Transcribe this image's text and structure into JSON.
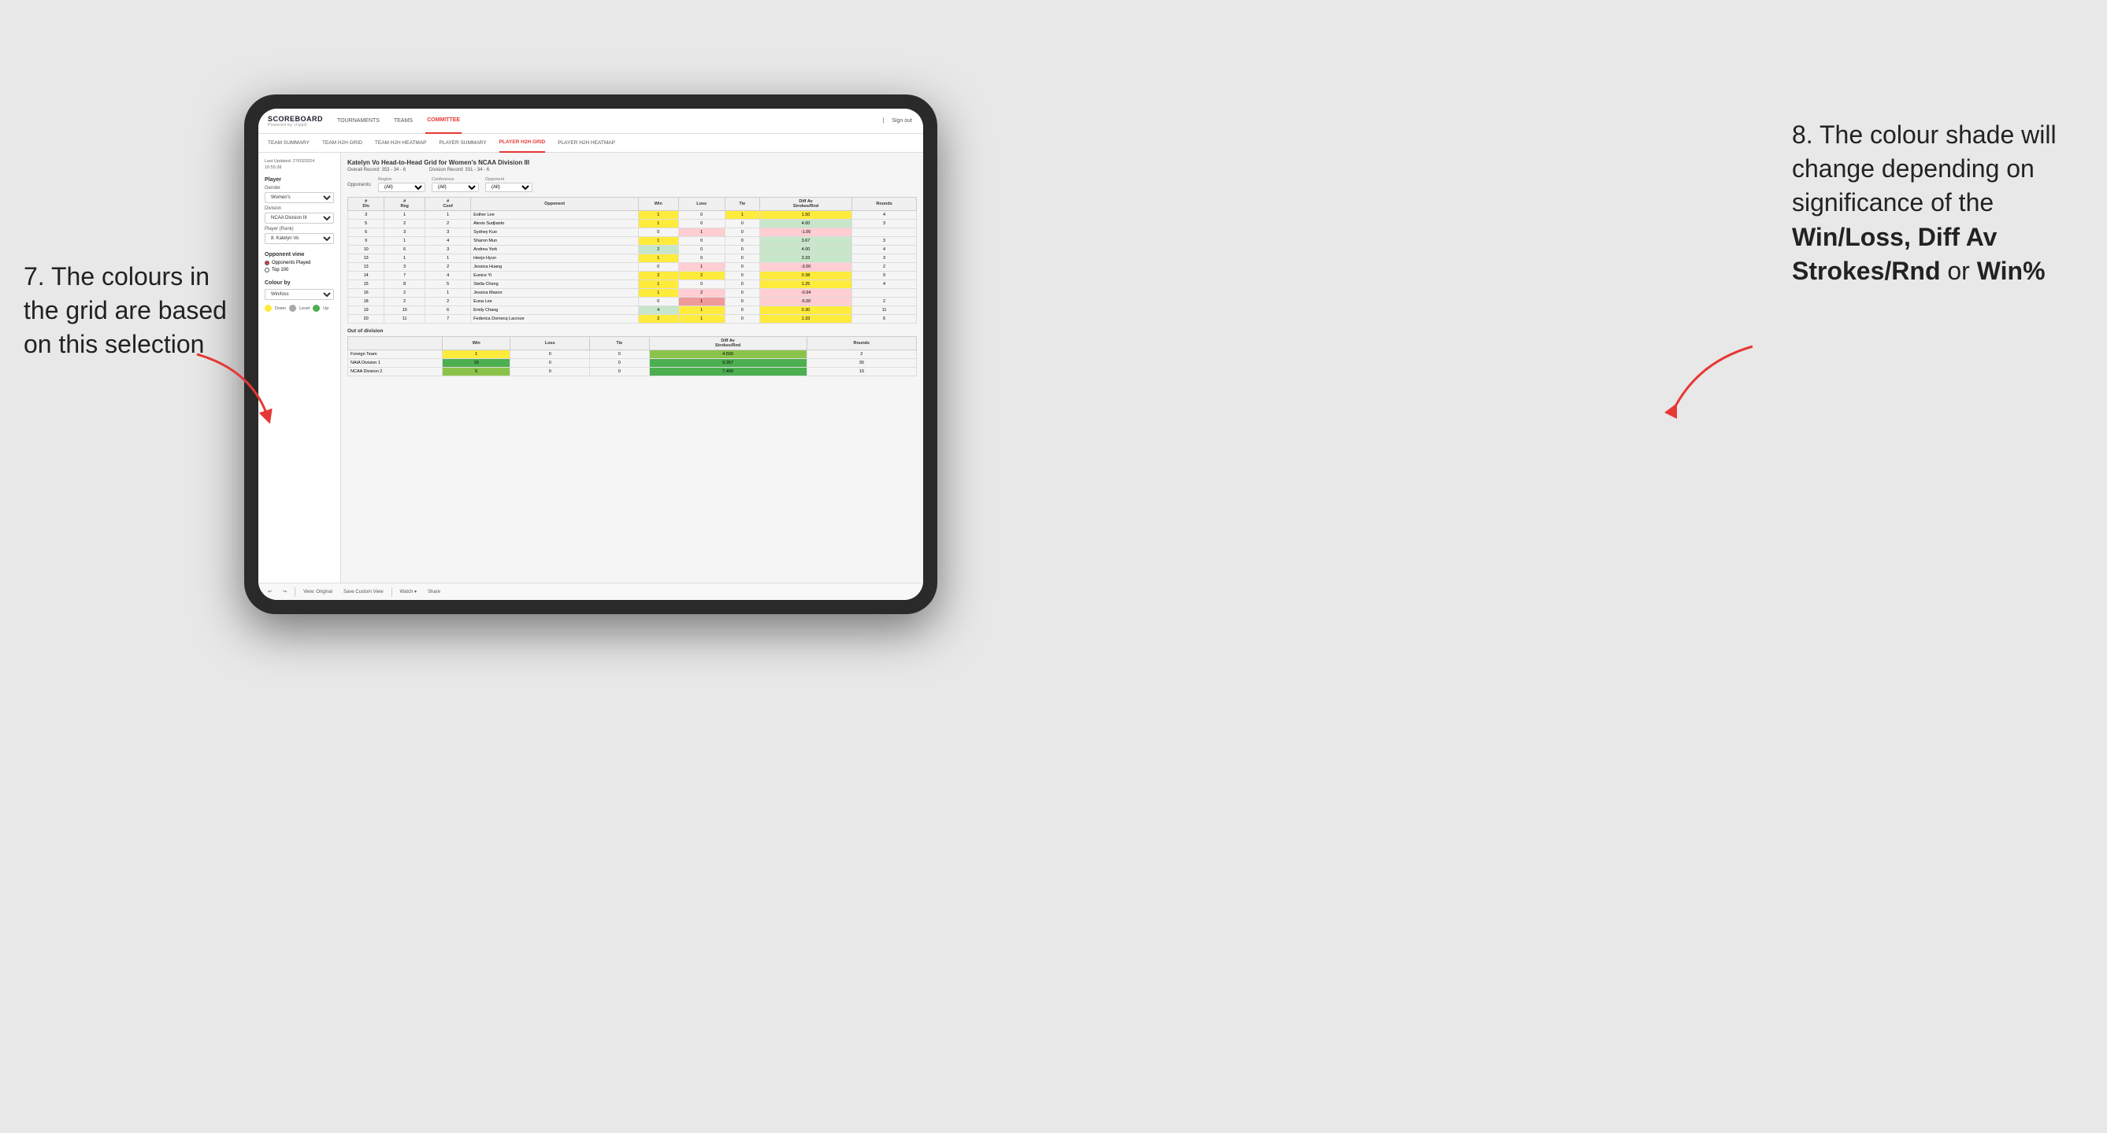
{
  "annotations": {
    "left_title": "7. The colours in the grid are based on this selection",
    "right_title": "8. The colour shade will change depending on significance of the",
    "right_bold1": "Win/Loss,",
    "right_bold2": "Diff Av Strokes/Rnd",
    "right_or": "or",
    "right_bold3": "Win%"
  },
  "nav": {
    "logo": "SCOREBOARD",
    "logo_sub": "Powered by clippd",
    "items": [
      "TOURNAMENTS",
      "TEAMS",
      "COMMITTEE"
    ],
    "right": [
      "Sign out"
    ],
    "active": "COMMITTEE"
  },
  "subnav": {
    "items": [
      "TEAM SUMMARY",
      "TEAM H2H GRID",
      "TEAM H2H HEATMAP",
      "PLAYER SUMMARY",
      "PLAYER H2H GRID",
      "PLAYER H2H HEATMAP"
    ],
    "active": "PLAYER H2H GRID"
  },
  "left_panel": {
    "last_updated_label": "Last Updated: 27/03/2024",
    "last_updated_time": "16:55:38",
    "player_section": "Player",
    "gender_label": "Gender",
    "gender_value": "Women's",
    "division_label": "Division",
    "division_value": "NCAA Division III",
    "player_rank_label": "Player (Rank)",
    "player_rank_value": "8. Katelyn Vo",
    "opponent_view_label": "Opponent view",
    "opponents_played_label": "Opponents Played",
    "top_100_label": "Top 100",
    "colour_by_label": "Colour by",
    "colour_by_value": "Win/loss",
    "legend_down": "Down",
    "legend_level": "Level",
    "legend_up": "Up"
  },
  "grid": {
    "title": "Katelyn Vo Head-to-Head Grid for Women's NCAA Division III",
    "overall_record_label": "Overall Record:",
    "overall_record_value": "353 - 34 - 6",
    "division_record_label": "Division Record:",
    "division_record_value": "331 - 34 - 6",
    "opponents_label": "Opponents:",
    "region_label": "Region",
    "conference_label": "Conference",
    "opponent_label": "Opponent",
    "filter_all": "(All)",
    "columns": {
      "div": "#\nDiv",
      "reg": "#\nReg",
      "conf": "#\nConf",
      "opponent": "Opponent",
      "win": "Win",
      "loss": "Loss",
      "tie": "Tie",
      "diff_av": "Diff Av\nStrokes/Rnd",
      "rounds": "Rounds"
    },
    "rows": [
      {
        "div": 3,
        "reg": 1,
        "conf": 1,
        "opponent": "Esther Lee",
        "win": 1,
        "loss": 0,
        "tie": 1,
        "diff_av": 1.5,
        "rounds": 4,
        "win_color": "yellow",
        "loss_color": "neutral",
        "tie_color": "yellow"
      },
      {
        "div": 5,
        "reg": 2,
        "conf": 2,
        "opponent": "Alexis Sudjianto",
        "win": 1,
        "loss": 0,
        "tie": 0,
        "diff_av": 4.0,
        "rounds": 3,
        "win_color": "yellow",
        "loss_color": "neutral",
        "tie_color": "neutral"
      },
      {
        "div": 6,
        "reg": 3,
        "conf": 3,
        "opponent": "Sydney Kuo",
        "win": 0,
        "loss": 1,
        "tie": 0,
        "diff_av": -1.0,
        "rounds": "",
        "win_color": "neutral",
        "loss_color": "red-light",
        "tie_color": "neutral"
      },
      {
        "div": 9,
        "reg": 1,
        "conf": 4,
        "opponent": "Sharon Mun",
        "win": 1,
        "loss": 0,
        "tie": 0,
        "diff_av": 3.67,
        "rounds": 3,
        "win_color": "yellow",
        "loss_color": "neutral",
        "tie_color": "neutral"
      },
      {
        "div": 10,
        "reg": 6,
        "conf": 3,
        "opponent": "Andrea York",
        "win": 2,
        "loss": 0,
        "tie": 0,
        "diff_av": 4.0,
        "rounds": 4,
        "win_color": "green-light",
        "loss_color": "neutral",
        "tie_color": "neutral"
      },
      {
        "div": 13,
        "reg": 1,
        "conf": 1,
        "opponent": "Heejo Hyun",
        "win": 1,
        "loss": 0,
        "tie": 0,
        "diff_av": 3.33,
        "rounds": 3,
        "win_color": "yellow",
        "loss_color": "neutral",
        "tie_color": "neutral"
      },
      {
        "div": 13,
        "reg": 3,
        "conf": 2,
        "opponent": "Jessica Huang",
        "win": 0,
        "loss": 1,
        "tie": 0,
        "diff_av": -3.0,
        "rounds": 2,
        "win_color": "neutral",
        "loss_color": "red-light",
        "tie_color": "neutral"
      },
      {
        "div": 14,
        "reg": 7,
        "conf": 4,
        "opponent": "Eunice Yi",
        "win": 2,
        "loss": 2,
        "tie": 0,
        "diff_av": 0.38,
        "rounds": 9,
        "win_color": "yellow",
        "loss_color": "yellow",
        "tie_color": "neutral"
      },
      {
        "div": 15,
        "reg": 8,
        "conf": 5,
        "opponent": "Stella Cheng",
        "win": 1,
        "loss": 0,
        "tie": 0,
        "diff_av": 1.25,
        "rounds": 4,
        "win_color": "yellow",
        "loss_color": "neutral",
        "tie_color": "neutral"
      },
      {
        "div": 16,
        "reg": 2,
        "conf": 1,
        "opponent": "Jessica Mason",
        "win": 1,
        "loss": 2,
        "tie": 0,
        "diff_av": -0.94,
        "rounds": "",
        "win_color": "yellow",
        "loss_color": "red-light",
        "tie_color": "neutral"
      },
      {
        "div": 18,
        "reg": 2,
        "conf": 2,
        "opponent": "Euna Lee",
        "win": 0,
        "loss": 1,
        "tie": 0,
        "diff_av": -5.0,
        "rounds": 2,
        "win_color": "neutral",
        "loss_color": "red-med",
        "tie_color": "neutral"
      },
      {
        "div": 19,
        "reg": 10,
        "conf": 6,
        "opponent": "Emily Chang",
        "win": 4,
        "loss": 1,
        "tie": 0,
        "diff_av": 0.3,
        "rounds": 11,
        "win_color": "green-light",
        "loss_color": "yellow",
        "tie_color": "neutral"
      },
      {
        "div": 20,
        "reg": 11,
        "conf": 7,
        "opponent": "Federica Domecq Lacroze",
        "win": 2,
        "loss": 1,
        "tie": 0,
        "diff_av": 1.33,
        "rounds": 6,
        "win_color": "yellow",
        "loss_color": "yellow",
        "tie_color": "neutral"
      }
    ],
    "out_of_division_label": "Out of division",
    "out_of_division_rows": [
      {
        "opponent": "Foreign Team",
        "win": 1,
        "loss": 0,
        "tie": 0,
        "diff_av": 4.5,
        "rounds": 2,
        "win_color": "yellow"
      },
      {
        "opponent": "NAIA Division 1",
        "win": 15,
        "loss": 0,
        "tie": 0,
        "diff_av": 9.267,
        "rounds": 30,
        "win_color": "green-dark"
      },
      {
        "opponent": "NCAA Division 2",
        "win": 5,
        "loss": 0,
        "tie": 0,
        "diff_av": 7.4,
        "rounds": 10,
        "win_color": "green-med"
      }
    ]
  },
  "toolbar": {
    "undo": "↩",
    "redo": "↪",
    "view_original": "View: Original",
    "save_custom": "Save Custom View",
    "watch": "Watch ▾",
    "share": "Share"
  }
}
